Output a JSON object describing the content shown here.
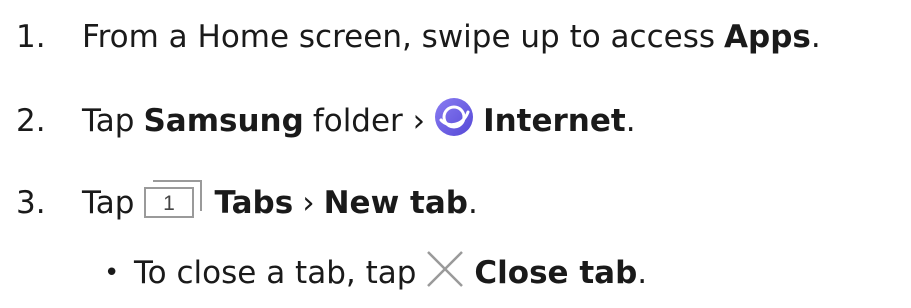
{
  "steps": [
    {
      "number": "1.",
      "pre": "From a Home screen, swipe up to access",
      "bold": "Apps",
      "post": "."
    },
    {
      "number": "2.",
      "tap": "Tap",
      "folder": "Samsung",
      "folder_suffix": "folder ›",
      "app": "Internet",
      "post": "."
    },
    {
      "number": "3.",
      "tap": "Tap",
      "tabs_icon_digit": "1",
      "tabs": "Tabs",
      "sep": "›",
      "new_tab": "New tab",
      "post": "."
    }
  ],
  "substep": {
    "bullet": "•",
    "pre": "To close a tab, tap",
    "bold": "Close tab",
    "post": "."
  },
  "icons": {
    "internet": "samsung-internet-icon",
    "tabs": "tabs-icon",
    "close": "close-icon"
  },
  "colors": {
    "text": "#1a1a1a",
    "internet_icon": "#6e64e8"
  }
}
